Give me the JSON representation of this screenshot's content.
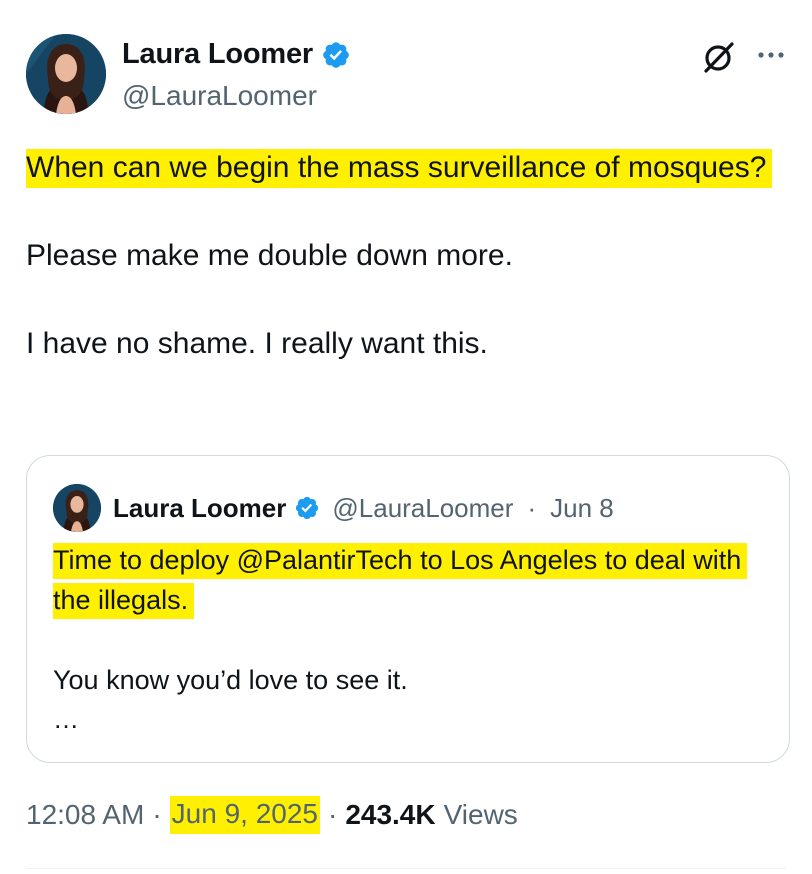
{
  "author": {
    "display_name": "Laura Loomer",
    "handle": "@LauraLoomer",
    "verified": true
  },
  "header_icons": [
    "grok-icon",
    "more-icon"
  ],
  "tweet": {
    "paragraphs": [
      "When can we begin the mass surveillance of mosques?",
      "Please make me double down more.",
      "I have no shame. I really want this."
    ]
  },
  "quoted_tweet": {
    "display_name": "Laura Loomer",
    "handle": "@LauraLoomer",
    "separator": "·",
    "date": "Jun 8",
    "text_highlighted": "Time to deploy @PalantirTech to Los Angeles to deal with the illegals.",
    "text_second": "You know you’d love to see it.",
    "ellipsis": "…"
  },
  "meta": {
    "time": "12:08 AM",
    "separator": "·",
    "date": "Jun 9, 2025",
    "views_count": "243.4K",
    "views_label": "Views"
  },
  "colors": {
    "highlight": "#ffef00",
    "verified_blue": "#1d9bf0",
    "secondary_text": "#536471",
    "primary_text": "#0f1419",
    "border": "#cfd9de"
  }
}
